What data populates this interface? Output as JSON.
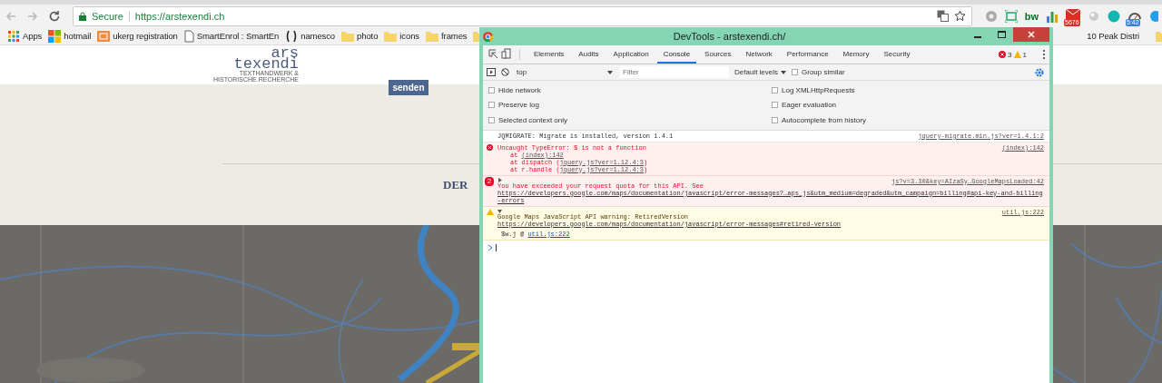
{
  "browser": {
    "secure_label": "Secure",
    "url": "https://arstexendi.ch",
    "extensions": [
      {
        "kind": "disc"
      },
      {
        "kind": "frame"
      },
      {
        "kind": "text",
        "label": "bw"
      },
      {
        "kind": "chart"
      },
      {
        "kind": "mail",
        "badge": "5676"
      },
      {
        "kind": "ball"
      },
      {
        "kind": "teal"
      },
      {
        "kind": "gauge",
        "badge": "5:42"
      },
      {
        "kind": "chat"
      }
    ]
  },
  "bookmarks": [
    {
      "kind": "apps",
      "label": "Apps"
    },
    {
      "kind": "windows",
      "label": "hotmail"
    },
    {
      "kind": "orange",
      "label": "ukerg registration"
    },
    {
      "kind": "page",
      "label": "SmartEnrol : SmartEn"
    },
    {
      "kind": "brackets",
      "label": "namesco"
    },
    {
      "kind": "folder",
      "label": "photo"
    },
    {
      "kind": "folder",
      "label": "icons"
    },
    {
      "kind": "folder",
      "label": "frames"
    },
    {
      "kind": "folder"
    }
  ],
  "bookmarks_right": [
    {
      "kind": "text",
      "label": "10 Peak Distri"
    },
    {
      "kind": "folder"
    }
  ],
  "site": {
    "logo_line1": "ars",
    "logo_line2": "texendi",
    "tagline_line1": "TEXTHANDWERK &",
    "tagline_line2": "HISTORISCHE RECHERCHE",
    "button": "senden",
    "heading": "DER"
  },
  "devtools": {
    "title": "DevTools - arstexendi.ch/",
    "tabs": [
      {
        "label": "Elements",
        "selected": false
      },
      {
        "label": "Audits",
        "selected": false
      },
      {
        "label": "Application",
        "selected": false
      },
      {
        "label": "Console",
        "selected": true
      },
      {
        "label": "Sources",
        "selected": false
      },
      {
        "label": "Network",
        "selected": false
      },
      {
        "label": "Performance",
        "selected": false
      },
      {
        "label": "Memory",
        "selected": false
      },
      {
        "label": "Security",
        "selected": false
      }
    ],
    "error_count": "3",
    "warning_count": "1",
    "context": "top",
    "filter_placeholder": "Filter",
    "levels": "Default levels",
    "group_similar": {
      "label": "Group similar",
      "checked": false
    },
    "settings_left": [
      {
        "label": "Hide network",
        "checked": false
      },
      {
        "label": "Preserve log",
        "checked": false
      },
      {
        "label": "Selected context only",
        "checked": false
      }
    ],
    "settings_right": [
      {
        "label": "Log XMLHttpRequests",
        "checked": false
      },
      {
        "label": "Eager evaluation",
        "checked": false
      },
      {
        "label": "Autocomplete from history",
        "checked": false
      }
    ],
    "messages": [
      {
        "kind": "log",
        "text": "JQMIGRATE: Migrate is installed, version 1.4.1",
        "source": "jquery-migrate.min.js?ver=1.4.1:2"
      },
      {
        "kind": "error",
        "text": "Uncaught TypeError: $ is not a function",
        "source": "(index):142",
        "stack": [
          {
            "prefix": "at ",
            "link": "(index):142"
          },
          {
            "prefix": "at dispatch (",
            "link": "jquery.js?ver=1.12.4:3",
            "suffix": ")"
          },
          {
            "prefix": "at r.handle (",
            "link": "jquery.js?ver=1.12.4:3",
            "suffix": ")"
          }
        ]
      },
      {
        "kind": "error",
        "repeat": "2",
        "expanded": false,
        "text": "You have exceeded your request quota for this API. See ",
        "link": "https://developers.google.com/maps/documentation/javascript/error-messages?…aps_js&utm_medium=degraded&utm_campaign=billing#api-key-and-billing-errors",
        "source": "js?v=3.30&key=AIzaSy…GoogleMapsLoaded:42"
      },
      {
        "kind": "warning",
        "expanded": true,
        "text": "Google Maps JavaScript API warning: RetiredVersion ",
        "link": "https://developers.google.com/maps/documentation/javascript/error-messages#retired-version",
        "source": "util.js:222",
        "stack": [
          {
            "prefix": "$w.j @ ",
            "link": "util.js:222"
          }
        ]
      }
    ]
  }
}
